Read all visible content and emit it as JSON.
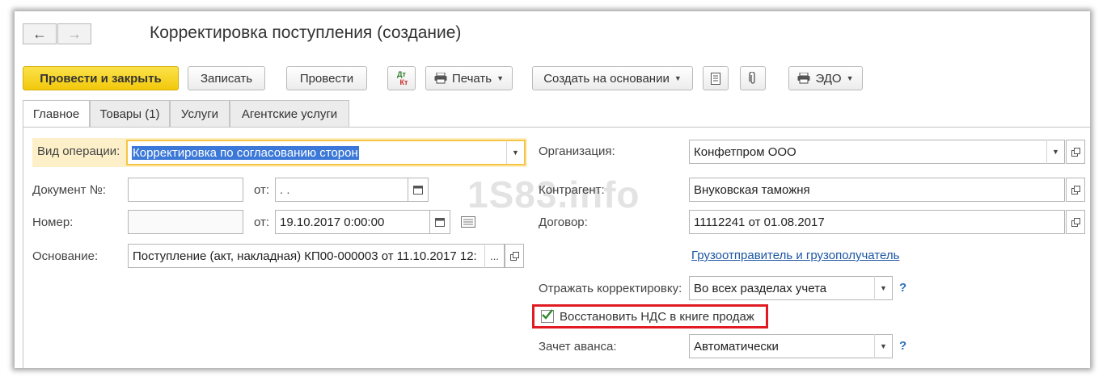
{
  "window": {
    "title": "Корректировка поступления (создание)"
  },
  "toolbar": {
    "post_close": "Провести и закрыть",
    "save": "Записать",
    "post": "Провести",
    "dtkt": "Дт Кт",
    "print": "Печать",
    "create_based": "Создать на основании",
    "edo": "ЭДО"
  },
  "tabs": [
    "Главное",
    "Товары (1)",
    "Услуги",
    "Агентские услуги"
  ],
  "form": {
    "operation_label": "Вид операции:",
    "operation_value": "Корректировка по согласованию сторон",
    "doc_no_label": "Документ №:",
    "doc_no_value": "",
    "from_label": "от:",
    "doc_date_value": " .  .",
    "number_label": "Номер:",
    "number_value": "",
    "number_date_value": "19.10.2017  0:00:00",
    "basis_label": "Основание:",
    "basis_value": "Поступление (акт, накладная) КП00-000003 от 11.10.2017 12:",
    "org_label": "Организация:",
    "org_value": "Конфетпром ООО",
    "counterparty_label": "Контрагент:",
    "counterparty_value": "Внуковская таможня",
    "contract_label": "Договор:",
    "contract_value": "11112241 от 01.08.2017",
    "shipper_link": "Грузоотправитель и грузополучатель",
    "reflect_label": "Отражать корректировку:",
    "reflect_value": "Во всех разделах учета",
    "restore_vat_label": "Восстановить НДС в книге продаж",
    "restore_vat_checked": true,
    "advance_label": "Зачет аванса:",
    "advance_value": "Автоматически",
    "help": "?"
  },
  "watermark": "1S83.info",
  "colors": {
    "primary": "#f2c80b",
    "highlight_border": "#e01b24",
    "link": "#1c56a3",
    "focus": "#f5c542"
  }
}
